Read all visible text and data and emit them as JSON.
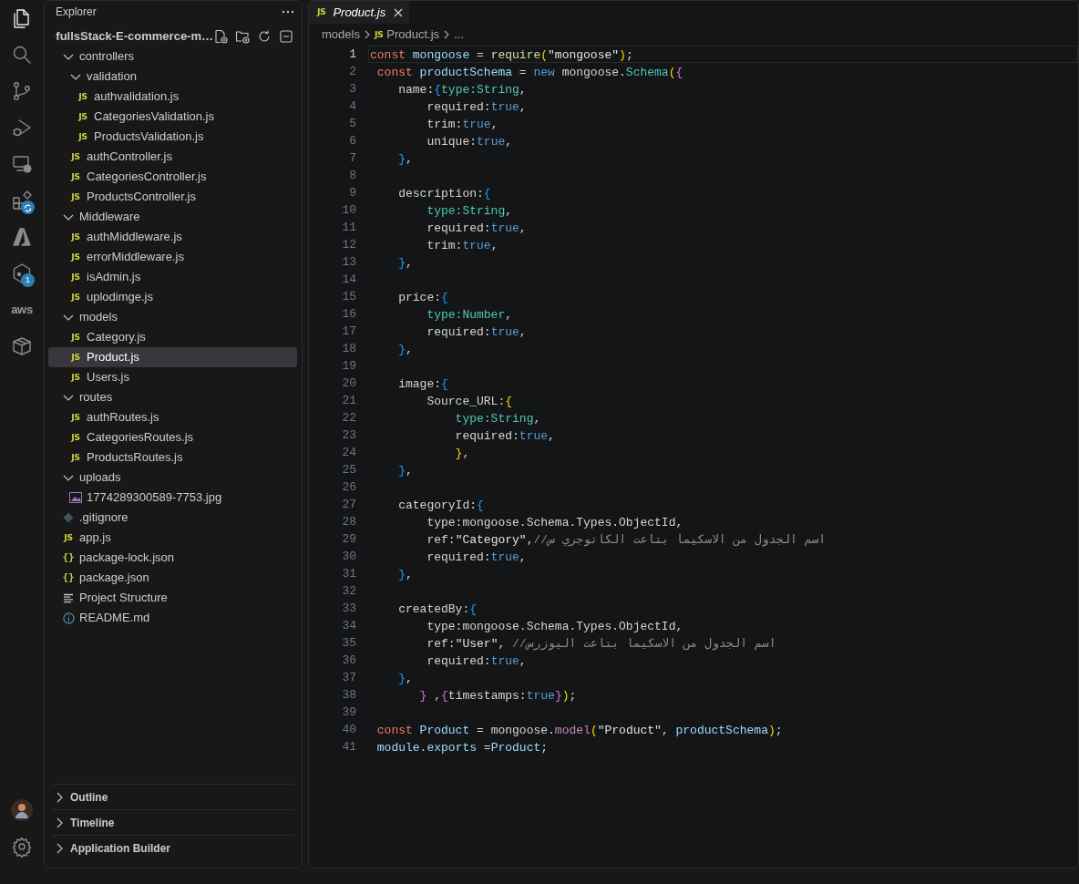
{
  "activity_bar": {
    "items": [
      {
        "kind": "explorer",
        "selected": true
      },
      {
        "kind": "search",
        "selected": false
      },
      {
        "kind": "source-control",
        "selected": false
      },
      {
        "kind": "run-debug",
        "selected": false
      },
      {
        "kind": "remote",
        "selected": false
      },
      {
        "kind": "extensions",
        "selected": false,
        "badge": {
          "kind": "sync"
        }
      },
      {
        "kind": "azure",
        "selected": false
      },
      {
        "kind": "hexagon",
        "selected": false,
        "badge": {
          "kind": "count",
          "text": "1"
        }
      },
      {
        "kind": "aws",
        "selected": false,
        "label": "aws"
      },
      {
        "kind": "box",
        "selected": false
      }
    ],
    "bottom": [
      {
        "kind": "account"
      },
      {
        "kind": "settings"
      }
    ]
  },
  "explorer": {
    "title": "Explorer",
    "root": {
      "label": "fullsStack-E-commerce-m…",
      "expanded": true,
      "children": [
        {
          "label": "controllers",
          "kind": "folder",
          "expanded": true,
          "selected": false,
          "children": [
            {
              "label": "validation",
              "kind": "folder",
              "expanded": true,
              "selected": false,
              "children": [
                {
                  "label": "authvalidation.js",
                  "kind": "js",
                  "icon_text": "JS",
                  "selected": false
                },
                {
                  "label": "CategoriesValidation.js",
                  "kind": "js",
                  "icon_text": "JS",
                  "selected": false
                },
                {
                  "label": "ProductsValidation.js",
                  "kind": "js",
                  "icon_text": "JS",
                  "selected": false
                }
              ]
            },
            {
              "label": "authController.js",
              "kind": "js",
              "icon_text": "JS",
              "selected": false
            },
            {
              "label": "CategoriesController.js",
              "kind": "js",
              "icon_text": "JS",
              "selected": false
            },
            {
              "label": "ProductsController.js",
              "kind": "js",
              "icon_text": "JS",
              "selected": false
            }
          ]
        },
        {
          "label": "Middleware",
          "kind": "folder",
          "expanded": true,
          "selected": false,
          "children": [
            {
              "label": "authMiddleware.js",
              "kind": "js",
              "icon_text": "JS",
              "selected": false
            },
            {
              "label": "errorMiddleware.js",
              "kind": "js",
              "icon_text": "JS",
              "selected": false
            },
            {
              "label": "isAdmin.js",
              "kind": "js",
              "icon_text": "JS",
              "selected": false
            },
            {
              "label": "uplodimge.js",
              "kind": "js",
              "icon_text": "JS",
              "selected": false
            }
          ]
        },
        {
          "label": "models",
          "kind": "folder",
          "expanded": true,
          "selected": false,
          "children": [
            {
              "label": "Category.js",
              "kind": "js",
              "icon_text": "JS",
              "selected": false
            },
            {
              "label": "Product.js",
              "kind": "js",
              "icon_text": "JS",
              "selected": true
            },
            {
              "label": "Users.js",
              "kind": "js",
              "icon_text": "JS",
              "selected": false
            }
          ]
        },
        {
          "label": "routes",
          "kind": "folder",
          "expanded": true,
          "selected": false,
          "children": [
            {
              "label": "authRoutes.js",
              "kind": "js",
              "icon_text": "JS",
              "selected": false
            },
            {
              "label": "CategoriesRoutes.js",
              "kind": "js",
              "icon_text": "JS",
              "selected": false
            },
            {
              "label": "ProductsRoutes.js",
              "kind": "js",
              "icon_text": "JS",
              "selected": false
            }
          ]
        },
        {
          "label": "uploads",
          "kind": "folder",
          "expanded": true,
          "selected": false,
          "children": [
            {
              "label": "1774289300589-7753.jpg",
              "kind": "image",
              "selected": false
            }
          ]
        },
        {
          "label": ".gitignore",
          "kind": "git",
          "selected": false
        },
        {
          "label": "app.js",
          "kind": "js",
          "icon_text": "JS",
          "selected": false
        },
        {
          "label": "package-lock.json",
          "kind": "json",
          "icon_text": "{}",
          "selected": false
        },
        {
          "label": "package.json",
          "kind": "json",
          "icon_text": "{}",
          "selected": false
        },
        {
          "label": "Project Structure",
          "kind": "text",
          "selected": false
        },
        {
          "label": "README.md",
          "kind": "info",
          "selected": false
        }
      ]
    }
  },
  "panels": [
    {
      "label": "Outline",
      "expanded": false
    },
    {
      "label": "Timeline",
      "expanded": false
    },
    {
      "label": "Application Builder",
      "expanded": false
    }
  ],
  "editor": {
    "tabs": [
      {
        "label": "Product.js",
        "kind": "js",
        "icon_text": "JS",
        "selected": true,
        "preview": true
      }
    ],
    "breadcrumb": [
      {
        "label": "models",
        "kind": "folder"
      },
      {
        "label": "Product.js",
        "kind": "js",
        "icon_text": "JS"
      },
      {
        "label": "...",
        "kind": "more"
      }
    ],
    "lines": [
      {
        "number": "1",
        "current": true,
        "tokens": [
          {
            "kind": "kw",
            "text": "const"
          },
          {
            "kind": "var",
            "text": " mongoose"
          },
          {
            "kind": "p",
            "text": " = "
          },
          {
            "kind": "fn",
            "text": "require"
          },
          {
            "kind": "b1",
            "text": "("
          },
          {
            "kind": "str",
            "text": "\"mongoose\""
          },
          {
            "kind": "b1",
            "text": ")"
          },
          {
            "kind": "p",
            "text": ";"
          }
        ]
      },
      {
        "number": "2",
        "current": false,
        "tokens": [
          {
            "kind": "kw",
            "text": " const"
          },
          {
            "kind": "var",
            "text": " productSchema"
          },
          {
            "kind": "p",
            "text": " = "
          },
          {
            "kind": "kw2",
            "text": "new"
          },
          {
            "kind": "p",
            "text": " mongoose."
          },
          {
            "kind": "type",
            "text": "Schema"
          },
          {
            "kind": "b1",
            "text": "("
          },
          {
            "kind": "b2",
            "text": "{"
          }
        ]
      },
      {
        "number": "3",
        "current": false,
        "tokens": [
          {
            "kind": "p",
            "text": "    name:"
          },
          {
            "kind": "b3",
            "text": "{"
          },
          {
            "kind": "type",
            "text": "type:String"
          },
          {
            "kind": "p",
            "text": ","
          }
        ]
      },
      {
        "number": "4",
        "current": false,
        "tokens": [
          {
            "kind": "p",
            "text": "        required:"
          },
          {
            "kind": "bool",
            "text": "true"
          },
          {
            "kind": "p",
            "text": ","
          }
        ]
      },
      {
        "number": "5",
        "current": false,
        "tokens": [
          {
            "kind": "p",
            "text": "        trim:"
          },
          {
            "kind": "bool",
            "text": "true"
          },
          {
            "kind": "p",
            "text": ","
          }
        ]
      },
      {
        "number": "6",
        "current": false,
        "tokens": [
          {
            "kind": "p",
            "text": "        unique:"
          },
          {
            "kind": "bool",
            "text": "true"
          },
          {
            "kind": "p",
            "text": ","
          }
        ]
      },
      {
        "number": "7",
        "current": false,
        "tokens": [
          {
            "kind": "b3",
            "text": "    }"
          },
          {
            "kind": "p",
            "text": ","
          }
        ]
      },
      {
        "number": "8",
        "current": false
      },
      {
        "number": "9",
        "current": false,
        "tokens": [
          {
            "kind": "p",
            "text": "    description:"
          },
          {
            "kind": "b3",
            "text": "{"
          }
        ]
      },
      {
        "number": "10",
        "current": false,
        "tokens": [
          {
            "kind": "type",
            "text": "        type:String"
          },
          {
            "kind": "p",
            "text": ","
          }
        ]
      },
      {
        "number": "11",
        "current": false,
        "tokens": [
          {
            "kind": "p",
            "text": "        required:"
          },
          {
            "kind": "bool",
            "text": "true"
          },
          {
            "kind": "p",
            "text": ","
          }
        ]
      },
      {
        "number": "12",
        "current": false,
        "tokens": [
          {
            "kind": "p",
            "text": "        trim:"
          },
          {
            "kind": "bool",
            "text": "true"
          },
          {
            "kind": "p",
            "text": ","
          }
        ]
      },
      {
        "number": "13",
        "current": false,
        "tokens": [
          {
            "kind": "b3",
            "text": "    }"
          },
          {
            "kind": "p",
            "text": ","
          }
        ]
      },
      {
        "number": "14",
        "current": false
      },
      {
        "number": "15",
        "current": false,
        "tokens": [
          {
            "kind": "p",
            "text": "    price:"
          },
          {
            "kind": "b3",
            "text": "{"
          }
        ]
      },
      {
        "number": "16",
        "current": false,
        "tokens": [
          {
            "kind": "type",
            "text": "        type:Number"
          },
          {
            "kind": "p",
            "text": ","
          }
        ]
      },
      {
        "number": "17",
        "current": false,
        "tokens": [
          {
            "kind": "p",
            "text": "        required:"
          },
          {
            "kind": "bool",
            "text": "true"
          },
          {
            "kind": "p",
            "text": ","
          }
        ]
      },
      {
        "number": "18",
        "current": false,
        "tokens": [
          {
            "kind": "b3",
            "text": "    }"
          },
          {
            "kind": "p",
            "text": ","
          }
        ]
      },
      {
        "number": "19",
        "current": false
      },
      {
        "number": "20",
        "current": false,
        "tokens": [
          {
            "kind": "p",
            "text": "    image:"
          },
          {
            "kind": "b3",
            "text": "{"
          }
        ]
      },
      {
        "number": "21",
        "current": false,
        "tokens": [
          {
            "kind": "p",
            "text": "        Source_URL:"
          },
          {
            "kind": "b1",
            "text": "{"
          }
        ]
      },
      {
        "number": "22",
        "current": false,
        "tokens": [
          {
            "kind": "type",
            "text": "            type:String"
          },
          {
            "kind": "p",
            "text": ","
          }
        ]
      },
      {
        "number": "23",
        "current": false,
        "tokens": [
          {
            "kind": "p",
            "text": "            required:"
          },
          {
            "kind": "bool",
            "text": "true"
          },
          {
            "kind": "p",
            "text": ","
          }
        ]
      },
      {
        "number": "24",
        "current": false,
        "tokens": [
          {
            "kind": "b1",
            "text": "            }"
          },
          {
            "kind": "p",
            "text": ","
          }
        ]
      },
      {
        "number": "25",
        "current": false,
        "tokens": [
          {
            "kind": "b3",
            "text": "    }"
          },
          {
            "kind": "p",
            "text": ","
          }
        ]
      },
      {
        "number": "26",
        "current": false
      },
      {
        "number": "27",
        "current": false,
        "tokens": [
          {
            "kind": "p",
            "text": "    categoryId:"
          },
          {
            "kind": "b3",
            "text": "{"
          }
        ]
      },
      {
        "number": "28",
        "current": false,
        "tokens": [
          {
            "kind": "p",
            "text": "        type:mongoose.Schema.Types.ObjectId,"
          }
        ]
      },
      {
        "number": "29",
        "current": false,
        "tokens": [
          {
            "kind": "p",
            "text": "        ref:"
          },
          {
            "kind": "str",
            "text": "\"Category\""
          },
          {
            "kind": "p",
            "text": ","
          },
          {
            "kind": "cm",
            "text": "//اسم الجدول من الاسكيما بتاعت الكاتوجري س"
          }
        ]
      },
      {
        "number": "30",
        "current": false,
        "tokens": [
          {
            "kind": "p",
            "text": "        required:"
          },
          {
            "kind": "bool",
            "text": "true"
          },
          {
            "kind": "p",
            "text": ","
          }
        ]
      },
      {
        "number": "31",
        "current": false,
        "tokens": [
          {
            "kind": "b3",
            "text": "    }"
          },
          {
            "kind": "p",
            "text": ","
          }
        ]
      },
      {
        "number": "32",
        "current": false
      },
      {
        "number": "33",
        "current": false,
        "tokens": [
          {
            "kind": "p",
            "text": "    createdBy:"
          },
          {
            "kind": "b3",
            "text": "{"
          }
        ]
      },
      {
        "number": "34",
        "current": false,
        "tokens": [
          {
            "kind": "p",
            "text": "        type:mongoose.Schema.Types.ObjectId,"
          }
        ]
      },
      {
        "number": "35",
        "current": false,
        "tokens": [
          {
            "kind": "p",
            "text": "        ref:"
          },
          {
            "kind": "str",
            "text": "\"User\""
          },
          {
            "kind": "p",
            "text": ", "
          },
          {
            "kind": "cm",
            "text": "//اسم الجدول من الاسكيما بتاعت اليوزرس"
          }
        ]
      },
      {
        "number": "36",
        "current": false,
        "tokens": [
          {
            "kind": "p",
            "text": "        required:"
          },
          {
            "kind": "bool",
            "text": "true"
          },
          {
            "kind": "p",
            "text": ","
          }
        ]
      },
      {
        "number": "37",
        "current": false,
        "tokens": [
          {
            "kind": "b3",
            "text": "    }"
          },
          {
            "kind": "p",
            "text": ","
          }
        ]
      },
      {
        "number": "38",
        "current": false,
        "tokens": [
          {
            "kind": "b2",
            "text": "       }"
          },
          {
            "kind": "p",
            "text": " ,"
          },
          {
            "kind": "b2",
            "text": "{"
          },
          {
            "kind": "p",
            "text": "timestamps:"
          },
          {
            "kind": "bool",
            "text": "true"
          },
          {
            "kind": "b2",
            "text": "}"
          },
          {
            "kind": "b1",
            "text": ")"
          },
          {
            "kind": "p",
            "text": ";"
          }
        ]
      },
      {
        "number": "39",
        "current": false
      },
      {
        "number": "40",
        "current": false,
        "tokens": [
          {
            "kind": "kw",
            "text": " const"
          },
          {
            "kind": "var",
            "text": " Product"
          },
          {
            "kind": "p",
            "text": " = mongoose."
          },
          {
            "kind": "method",
            "text": "model"
          },
          {
            "kind": "b1",
            "text": "("
          },
          {
            "kind": "str",
            "text": "\"Product\""
          },
          {
            "kind": "p",
            "text": ", "
          },
          {
            "kind": "var",
            "text": "productSchema"
          },
          {
            "kind": "b1",
            "text": ")"
          },
          {
            "kind": "p",
            "text": ";"
          }
        ]
      },
      {
        "number": "41",
        "current": false,
        "tokens": [
          {
            "kind": "var",
            "text": " module"
          },
          {
            "kind": "p",
            "text": "."
          },
          {
            "kind": "var",
            "text": "exports"
          },
          {
            "kind": "p",
            "text": " ="
          },
          {
            "kind": "var",
            "text": "Product"
          },
          {
            "kind": "p",
            "text": ";"
          }
        ]
      }
    ]
  }
}
